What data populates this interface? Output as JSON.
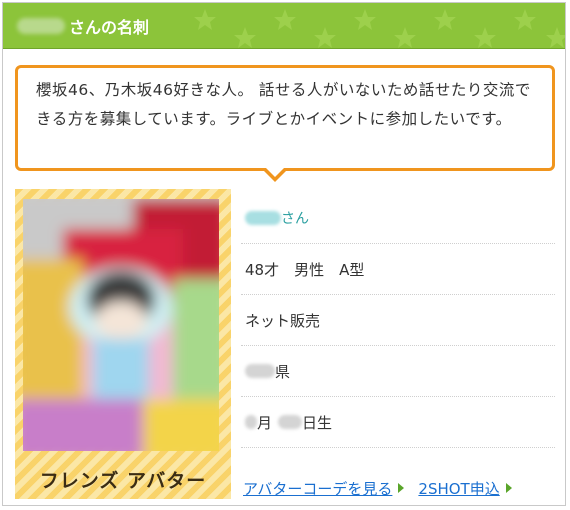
{
  "header": {
    "title_suffix": "さんの名刺"
  },
  "bio": {
    "text": "櫻坂46、乃木坂46好きな人。 話せる人がいないため話せたり交流できる方を募集しています。ライブとかイベントに参加したいです。"
  },
  "avatar": {
    "label": "フレンズ アバター"
  },
  "profile": {
    "name_suffix": "さん",
    "demographics": "48才　男性　A型",
    "occupation": "ネット販売",
    "prefecture_suffix": "県",
    "birthday_month_suffix": "月",
    "birthday_day_suffix": "日生"
  },
  "links": {
    "avatar_coordinate": "アバターコーデを見る",
    "twoshot": "2SHOT申込"
  },
  "colors": {
    "header_green": "#8cc43a",
    "bubble_orange": "#f0951e",
    "link_blue": "#1a6fd0",
    "name_teal": "#2a9fa0"
  }
}
